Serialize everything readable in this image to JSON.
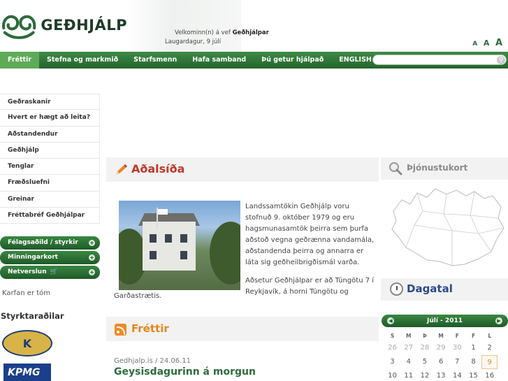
{
  "header": {
    "logo_text": "GEÐHJÁLP",
    "welcome_prefix": "Velkominn(n) á vef ",
    "welcome_name": "Geðhjálpar",
    "date_line": "Laugardagur, 9 júlí",
    "font_sizes": [
      "A",
      "A",
      "A"
    ]
  },
  "nav": {
    "items": [
      "Fréttir",
      "Stefna og markmið",
      "Starfsmenn",
      "Hafa samband",
      "Þú getur hjálpað",
      "ENGLISH"
    ],
    "active_index": 0,
    "search_placeholder": ""
  },
  "sidebar": {
    "links": [
      "Geðraskanir",
      "Hvert er hægt að leita?",
      "Aðstandendur",
      "Geðhjálp",
      "Tenglar",
      "Fræðsluefni",
      "Greinar",
      "Fréttabréf Geðhjálpar"
    ],
    "buttons": [
      "Félagsaðild / styrkir",
      "Minningarkort",
      "Netverslun"
    ],
    "cart_text": "Karfan er tóm",
    "sponsors_title": "Styrktaraðilar",
    "sponsor_logos": [
      "Kiwanis",
      "KPMG"
    ]
  },
  "main": {
    "title": "Aðalsíða",
    "paragraph1": "Landssamtökin Geðhjálp voru stofnuð 9. október 1979 og eru hagsmunasamtök þeirra sem þurfa aðstoð vegna geðrænna vandamála, aðstandenda þeirra og annarra er láta sig geðheilbrigðismál varða.",
    "paragraph2": "Aðsetur Geðhjálpar er að Túngötu 7 í Reykjavík, á horni Túngötu og",
    "paragraph2_tail": "Garðastrætis.",
    "news_title": "Fréttir",
    "news_meta": "Gedhjalp.is / 24.06.11",
    "news_headline": "Geysisdagurinn á morgun"
  },
  "right": {
    "service_title": "Þjónustukort",
    "calendar_title": "Dagatal",
    "month_label": "Júlí - 2011",
    "weekdays": [
      "S",
      "M",
      "Þ",
      "M",
      "F",
      "F",
      "L"
    ],
    "weeks": [
      [
        "26",
        "27",
        "28",
        "29",
        "30",
        "1",
        "2"
      ],
      [
        "3",
        "4",
        "5",
        "6",
        "7",
        "8",
        "9"
      ],
      [
        "10",
        "11",
        "12",
        "13",
        "14",
        "15",
        "16"
      ]
    ],
    "today": "9"
  },
  "colors": {
    "nav_green": "#24642b",
    "nav_active": "#5faa58",
    "title_red": "#c0392b",
    "news_orange": "#e5861f",
    "calendar_blue": "#2a4a8a"
  }
}
